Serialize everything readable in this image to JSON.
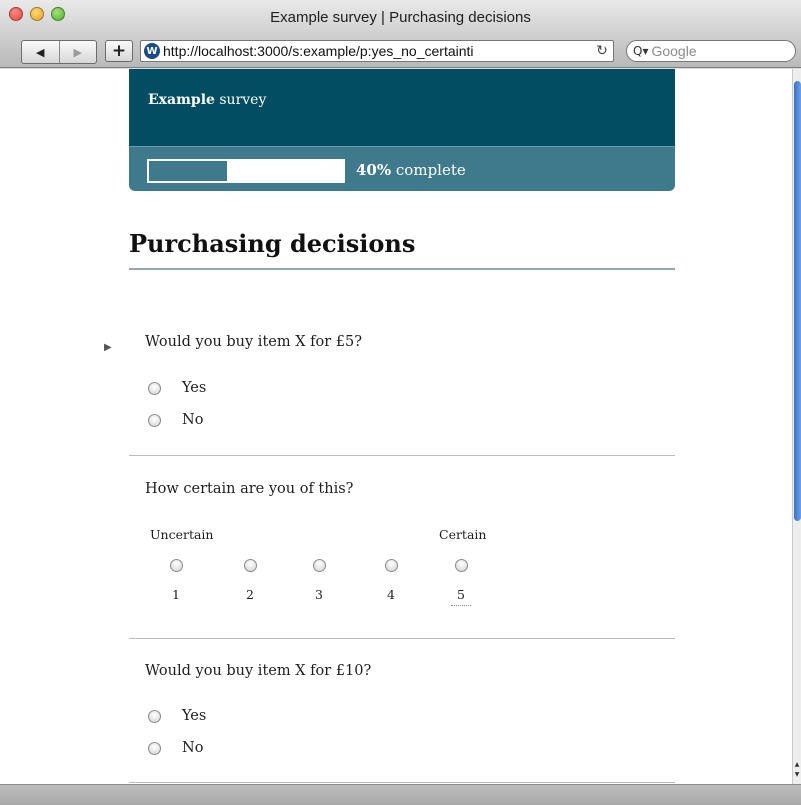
{
  "window": {
    "title": "Example survey | Purchasing decisions"
  },
  "toolbar": {
    "back_icon": "◀",
    "forward_icon": "▶",
    "add_icon": "+",
    "favicon": "W",
    "url": "http://localhost:3000/s:example/p:yes_no_certainti",
    "reload_icon": "↻",
    "search_icon": "Q▾",
    "search_placeholder": "Google"
  },
  "survey": {
    "name_bold": "Example",
    "name_rest": " survey",
    "progress_value": "40%",
    "progress_text": " complete",
    "progress_fraction": 0.4
  },
  "page": {
    "heading": "Purchasing decisions"
  },
  "questions": [
    {
      "text": "Would you buy item X for £5?",
      "options": [
        "Yes",
        "No"
      ]
    },
    {
      "text": "How certain are you of this?",
      "scale_low": "Uncertain",
      "scale_high": "Certain",
      "scale": [
        "1",
        "2",
        "3",
        "4",
        "5"
      ]
    },
    {
      "text": "Would you buy item X for £10?",
      "options": [
        "Yes",
        "No"
      ]
    }
  ],
  "colors": {
    "header": "#034d63",
    "progress_band": "#3e7a8c",
    "rule": "#8ea9b3"
  }
}
